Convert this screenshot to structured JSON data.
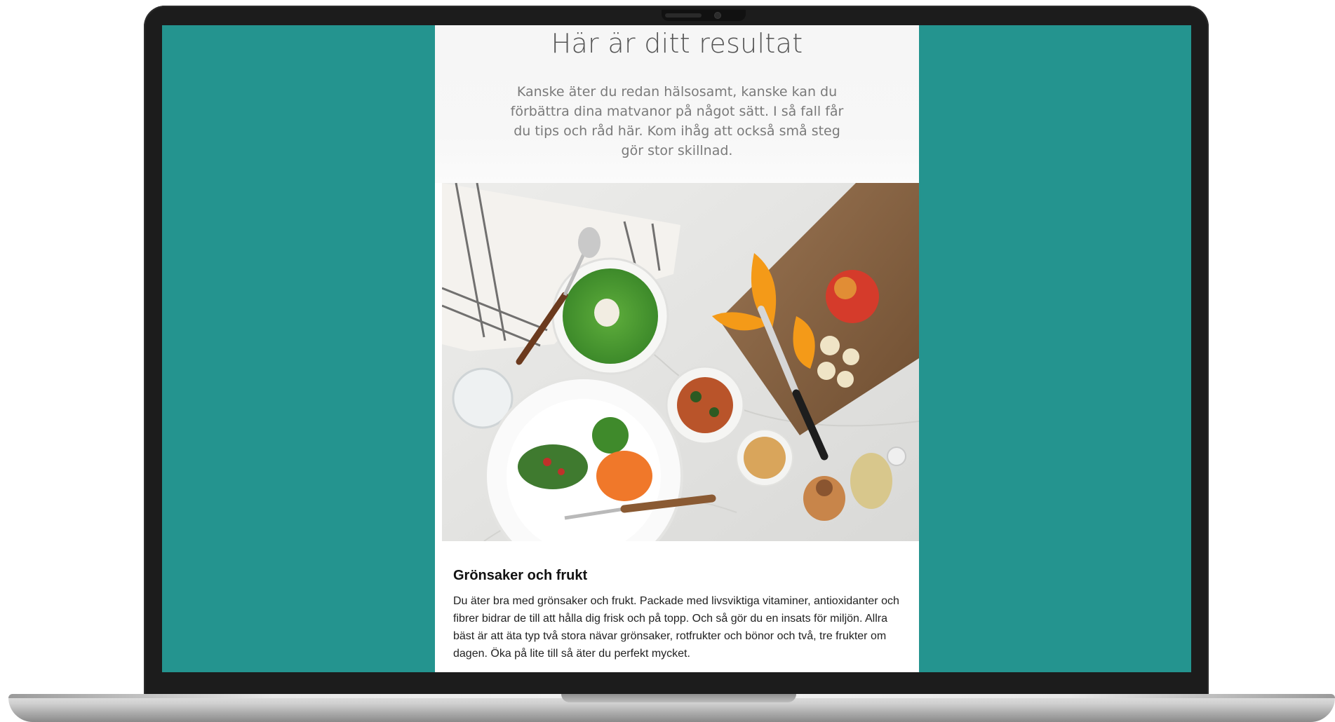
{
  "colors": {
    "screen_background": "#24948f",
    "page_background": "#ffffff",
    "hero_background": "#f7f7f7"
  },
  "hero": {
    "title": "Här är ditt resultat",
    "text": "Kanske äter du redan hälsosamt, kanske kan du förbättra dina matvanor på något sätt. I så fall får du tips och råd här. Kom ihåg att också små steg gör stor skillnad."
  },
  "photo": {
    "icon": "food-photo-icon"
  },
  "article": {
    "heading": "Grönsaker och frukt",
    "body": "Du äter bra med grönsaker och frukt. Packade med livsviktiga vitaminer, antioxidanter och fibrer bidrar de till att hålla dig frisk och på topp. Och så gör du en insats för miljön. Allra bäst är att äta typ två stora nävar grönsaker, rotfrukter och bönor och två, tre frukter om dagen. Öka på lite till så äter du perfekt mycket."
  }
}
